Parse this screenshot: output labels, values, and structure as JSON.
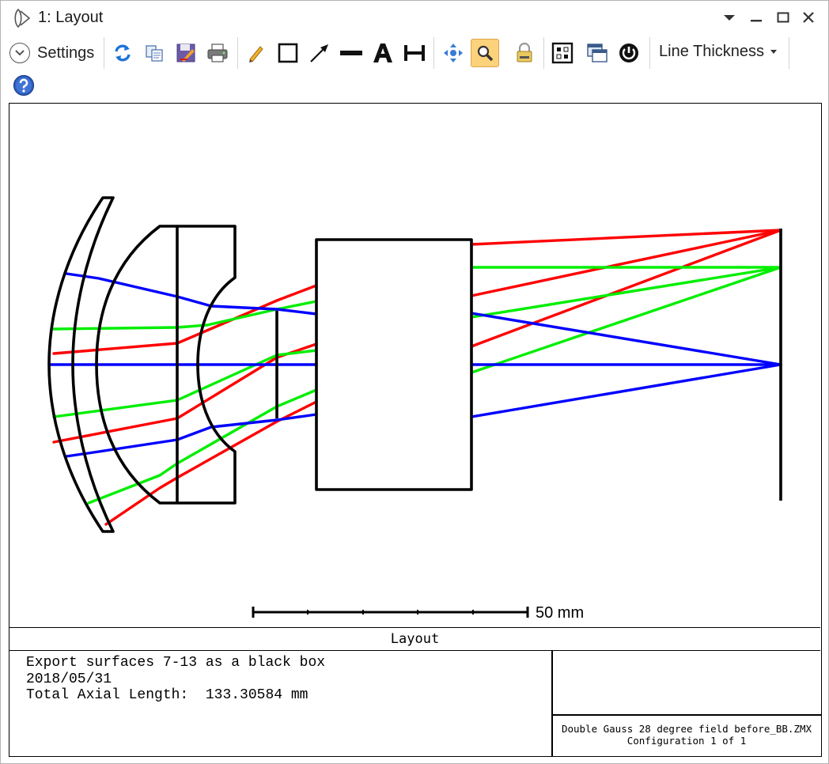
{
  "window": {
    "title": "1: Layout",
    "icons": {
      "app": "lens-icon",
      "menu": "dropdown-triangle-icon",
      "minimize": "minimize-icon",
      "maximize": "maximize-icon",
      "close": "close-icon"
    }
  },
  "toolbar": {
    "settings_label": "Settings",
    "line_thickness_label": "Line Thickness",
    "buttons": [
      {
        "icon": "refresh-icon"
      },
      {
        "icon": "copy-icon"
      },
      {
        "icon": "save-icon"
      },
      {
        "icon": "print-icon"
      },
      {
        "icon": "pencil-icon"
      },
      {
        "icon": "rectangle-icon"
      },
      {
        "icon": "arrow-line-icon"
      },
      {
        "icon": "thick-line-icon"
      },
      {
        "icon": "text-icon"
      },
      {
        "icon": "dimension-icon"
      },
      {
        "icon": "pan-icon"
      },
      {
        "icon": "zoom-icon",
        "active": true
      },
      {
        "icon": "lock-icon"
      },
      {
        "icon": "grid-icon"
      },
      {
        "icon": "windows-icon"
      },
      {
        "icon": "power-icon"
      },
      {
        "icon": "help-icon"
      }
    ]
  },
  "plot": {
    "scale_label": "50 mm",
    "frame_title": "Layout",
    "info_line1": "Export surfaces 7-13 as a black box",
    "info_line2": "2018/05/31",
    "info_line3": "Total Axial Length:  133.30584 mm",
    "file_line1": "Double Gauss 28 degree field before_BB.ZMX",
    "file_line2": "Configuration 1 of 1",
    "ray_colors": {
      "field1": "#0000ff",
      "field2": "#00ee00",
      "field3": "#ff0000"
    },
    "lens_color": "#000000"
  }
}
